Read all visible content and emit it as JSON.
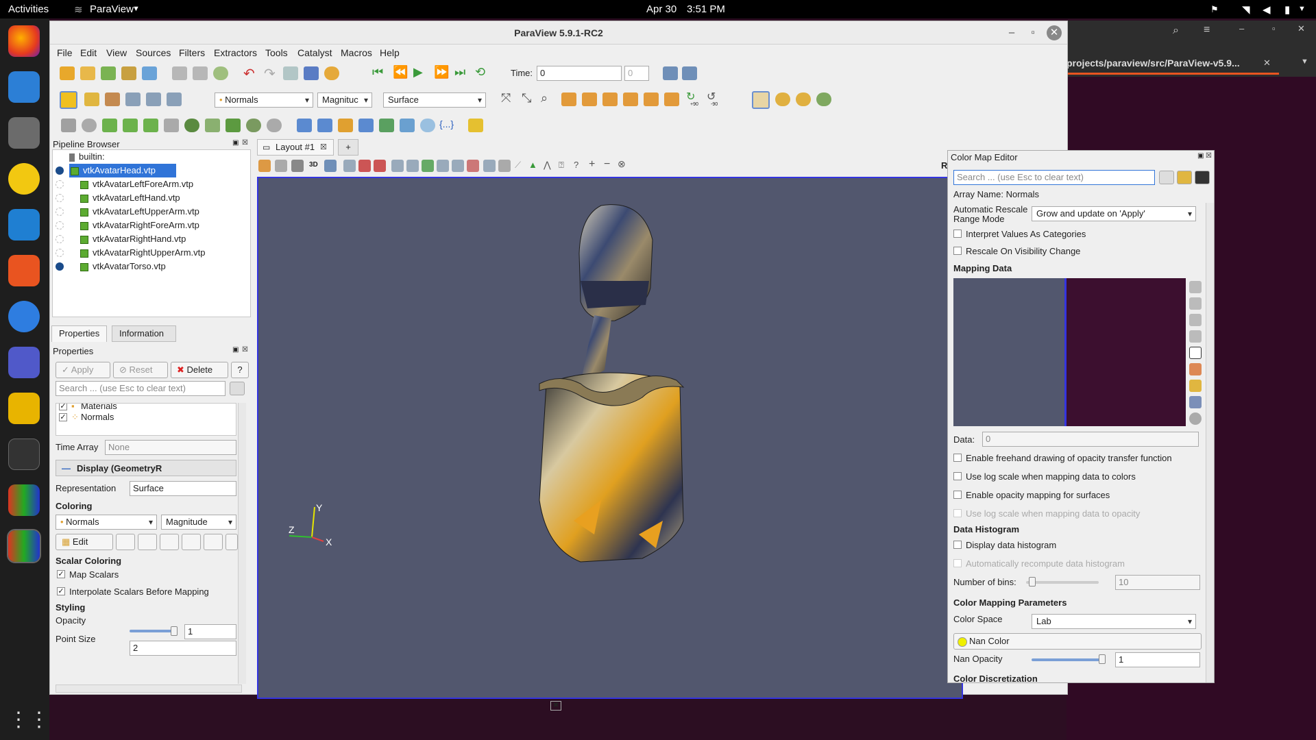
{
  "topbar": {
    "activities": "Activities",
    "app": "ParaView",
    "date": "Apr 30",
    "time": "3:51 PM"
  },
  "bg_terminal": {
    "tab": "projects/paraview/src/ParaView-v5.9..."
  },
  "window": {
    "title": "ParaView 5.9.1-RC2"
  },
  "menu": [
    "File",
    "Edit",
    "View",
    "Sources",
    "Filters",
    "Extractors",
    "Tools",
    "Catalyst",
    "Macros",
    "Help"
  ],
  "toolbar": {
    "time_label": "Time:",
    "time_value": "0",
    "time_step": "0",
    "color_by": "Normals",
    "component": "Magnituc",
    "representation": "Surface",
    "rot_plus": "+90",
    "rot_minus": "-90"
  },
  "pipeline": {
    "title": "Pipeline Browser",
    "root": "builtin:",
    "items": [
      "vtkAvatarHead.vtp",
      "vtkAvatarLeftForeArm.vtp",
      "vtkAvatarLeftHand.vtp",
      "vtkAvatarLeftUpperArm.vtp",
      "vtkAvatarRightForeArm.vtp",
      "vtkAvatarRightHand.vtp",
      "vtkAvatarRightUpperArm.vtp",
      "vtkAvatarTorso.vtp"
    ]
  },
  "props": {
    "tab_properties": "Properties",
    "tab_information": "Information",
    "title": "Properties",
    "apply": "Apply",
    "reset": "Reset",
    "delete": "Delete",
    "help": "?",
    "search_ph": "Search ... (use Esc to clear text)",
    "arr_materials": "Materials",
    "arr_normals": "Normals",
    "time_array_label": "Time Array",
    "time_array_value": "None",
    "display_section": "Display (GeometryR",
    "representation_label": "Representation",
    "representation_value": "Surface",
    "coloring": "Coloring",
    "color_by": "Normals",
    "component": "Magnitude",
    "edit": "Edit",
    "scalar_coloring": "Scalar Coloring",
    "map_scalars": "Map Scalars",
    "interpolate": "Interpolate Scalars Before Mapping",
    "styling": "Styling",
    "opacity_label": "Opacity",
    "opacity_value": "1",
    "point_size_label": "Point Size",
    "point_size_value": "2"
  },
  "view": {
    "layout_tab": "Layout #1",
    "add_tab": "+",
    "btn_3d": "3D",
    "render_label": "Rend",
    "axis_x": "X",
    "axis_y": "Y",
    "axis_z": "Z"
  },
  "cme": {
    "title": "Color Map Editor",
    "search_ph": "Search ... (use Esc to clear text)",
    "array_name": "Array Name: Normals",
    "auto_rescale_label_1": "Automatic Rescale",
    "auto_rescale_label_2": "Range Mode",
    "auto_rescale_value": "Grow and update on 'Apply'",
    "interpret": "Interpret Values As Categories",
    "rescale_visibility": "Rescale On Visibility Change",
    "mapping_data": "Mapping Data",
    "data_label": "Data:",
    "data_value": "0",
    "freehand": "Enable freehand drawing of opacity transfer function",
    "log_colors": "Use log scale when mapping data to colors",
    "opacity_surfaces": "Enable opacity mapping for surfaces",
    "log_opacity": "Use log scale when mapping data to opacity",
    "histogram": "Data Histogram",
    "display_hist": "Display data histogram",
    "auto_recompute": "Automatically recompute data histogram",
    "bins_label": "Number of bins:",
    "bins_value": "10",
    "cmp": "Color Mapping Parameters",
    "color_space_label": "Color Space",
    "color_space_value": "Lab",
    "nan_color": "Nan Color",
    "nan_opacity_label": "Nan Opacity",
    "nan_opacity_value": "1",
    "color_disc": "Color Discretization"
  },
  "colors": {
    "render_bg": "#52576e",
    "selection": "#3074d8",
    "mapping_left": "#52576e",
    "mapping_right": "#3c0f2f"
  }
}
